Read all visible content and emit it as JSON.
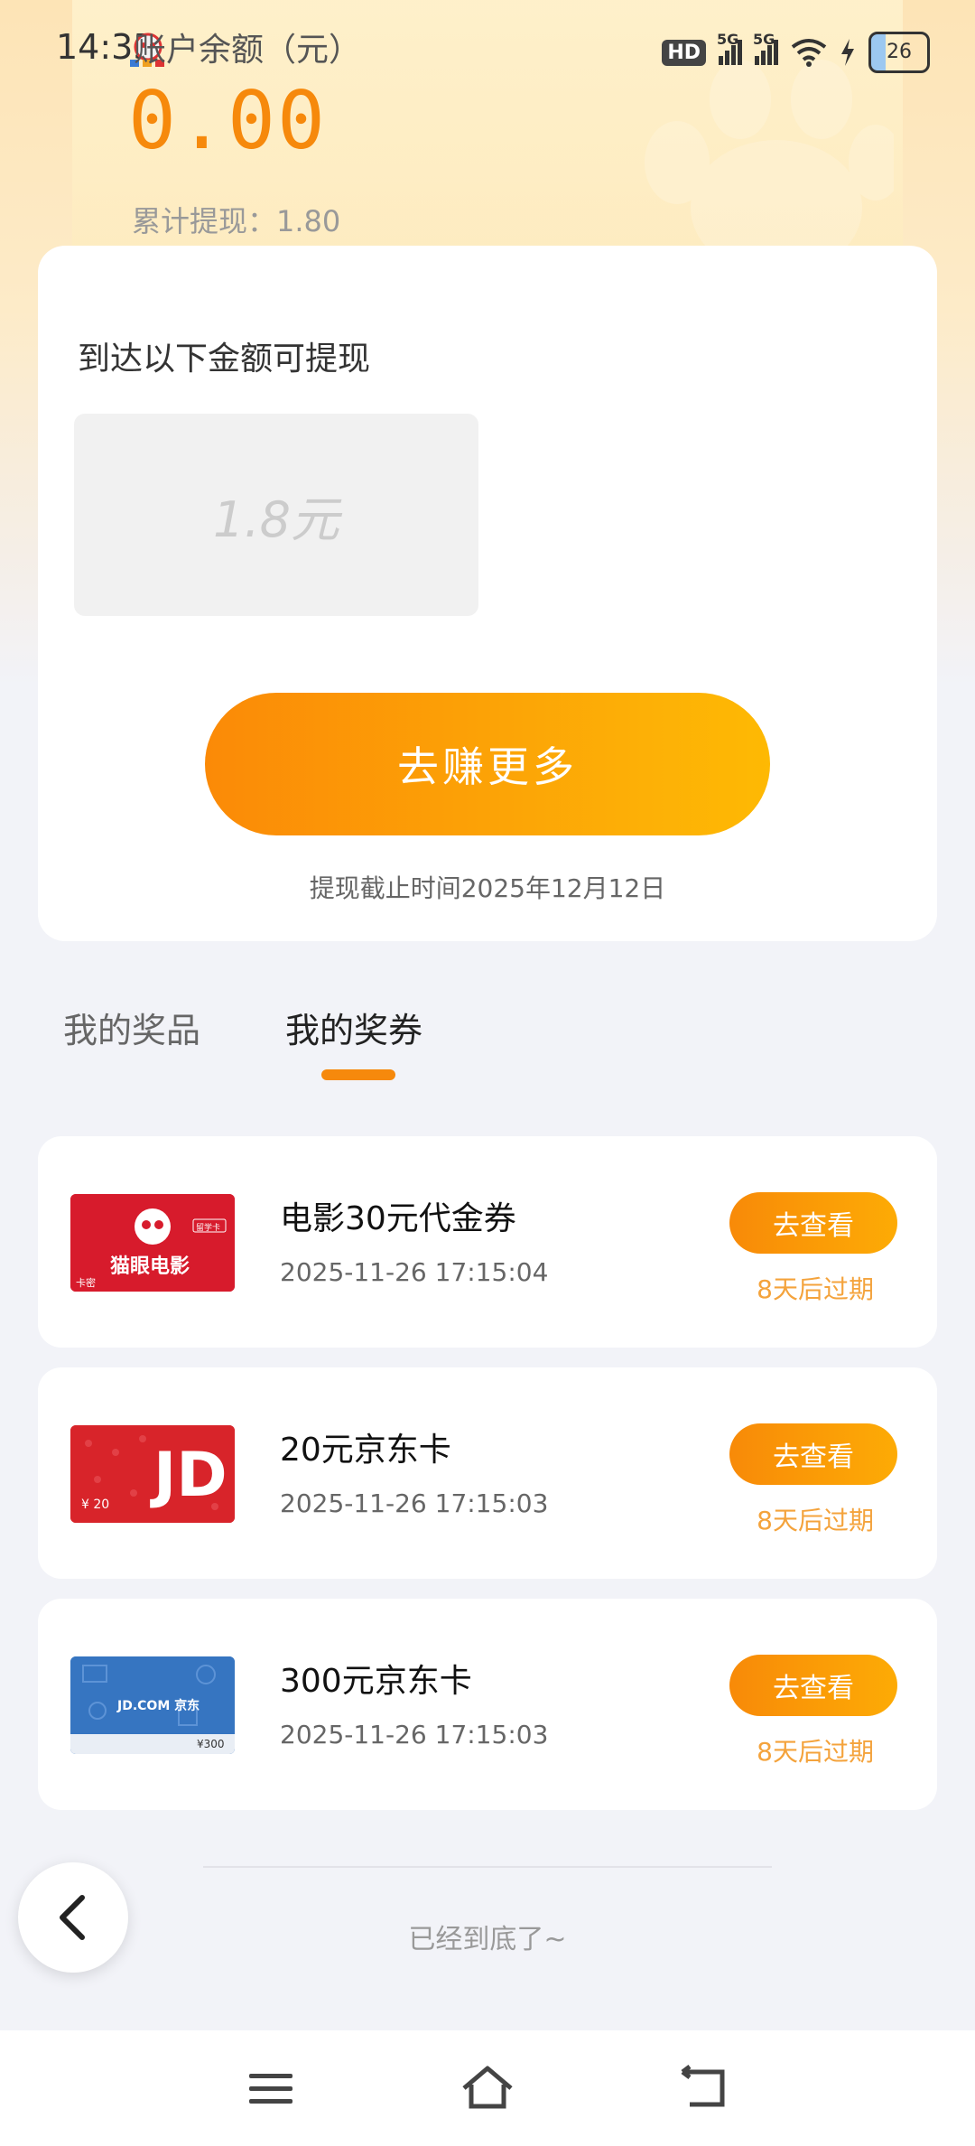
{
  "status": {
    "time": "14:35",
    "hd": "HD",
    "sim1": "5G",
    "sim2": "5G",
    "battery": "26"
  },
  "header": {
    "balance_label": "账户余额（元）",
    "balance": "0.00",
    "cumulative": "累计提现：1.80"
  },
  "withdraw": {
    "reach_label": "到达以下金额可提现",
    "amount": "1.8元",
    "earn_button": "去赚更多",
    "deadline": "提现截止时间2025年12月12日"
  },
  "tabs": {
    "prizes": "我的奖品",
    "coupons": "我的奖券",
    "active": "coupons"
  },
  "coupons": [
    {
      "title": "电影30元代金券",
      "time": "2025-11-26 17:15:04",
      "button": "去查看",
      "expire": "8天后过期",
      "thumb_icon": "maoyan-movie-card",
      "thumb_text": "猫眼电影",
      "thumb_badge": "留学卡",
      "thumb_corner": "卡密"
    },
    {
      "title": "20元京东卡",
      "time": "2025-11-26 17:15:03",
      "button": "去查看",
      "expire": "8天后过期",
      "thumb_icon": "jd-card-20",
      "thumb_text": "JD",
      "thumb_value": "¥ 20"
    },
    {
      "title": "300元京东卡",
      "time": "2025-11-26 17:15:03",
      "button": "去查看",
      "expire": "8天后过期",
      "thumb_icon": "jd-card-300",
      "thumb_text": "JD.COM 京东",
      "thumb_value": "¥300"
    }
  ],
  "footer": {
    "end_text": "已经到底了~"
  },
  "colors": {
    "accent": "#f6890c",
    "expire": "#f4a33c"
  }
}
